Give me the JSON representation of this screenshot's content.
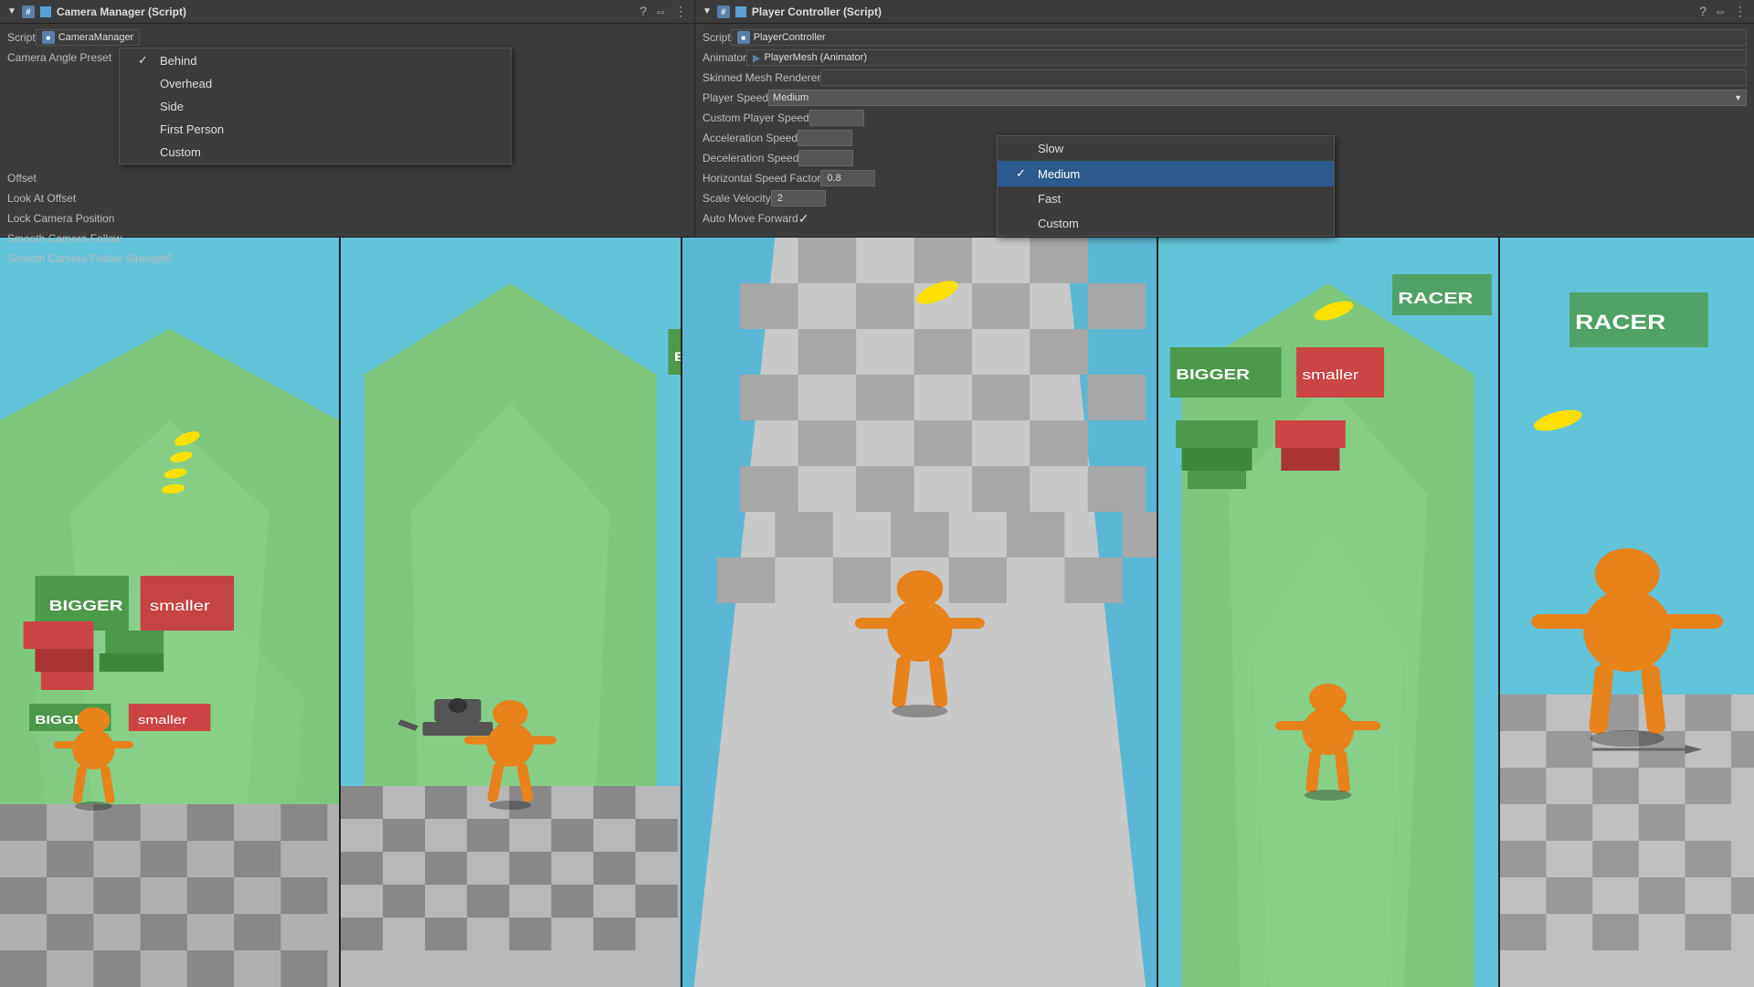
{
  "camera_panel": {
    "title": "Camera Manager (Script)",
    "script_field": "CameraManager",
    "fields": [
      {
        "label": "Script",
        "value": "CameraManager"
      },
      {
        "label": "Camera Angle Preset",
        "value": ""
      },
      {
        "label": "Offset",
        "value": ""
      },
      {
        "label": "Look At Offset",
        "value": ""
      },
      {
        "label": "Lock Camera Position",
        "value": ""
      },
      {
        "label": "Smooth Camera Follow",
        "value": ""
      },
      {
        "label": "Smooth Camera Follow Strength",
        "value": "6"
      }
    ],
    "dropdown": {
      "options": [
        {
          "label": "Behind",
          "selected": true
        },
        {
          "label": "Overhead",
          "selected": false
        },
        {
          "label": "Side",
          "selected": false
        },
        {
          "label": "First Person",
          "selected": false
        },
        {
          "label": "Custom",
          "selected": false
        }
      ]
    }
  },
  "player_panel": {
    "title": "Player Controller (Script)",
    "script_field": "PlayerController",
    "animator_label": "Animator",
    "animator_value": "PlayerMesh (Animator)",
    "skinned_mesh_label": "Skinned Mesh Renderer",
    "fields": [
      {
        "label": "Script",
        "value": "PlayerController"
      },
      {
        "label": "Animator",
        "value": "PlayerMesh (Animator)"
      },
      {
        "label": "Skinned Mesh Renderer",
        "value": ""
      },
      {
        "label": "Player Speed",
        "value": ""
      },
      {
        "label": "Custom Player Speed",
        "value": ""
      },
      {
        "label": "Acceleration Speed",
        "value": ""
      },
      {
        "label": "Deceleration Speed",
        "value": ""
      },
      {
        "label": "Horizontal Speed Factor",
        "value": "0.8"
      },
      {
        "label": "Scale Velocity",
        "value": "2"
      },
      {
        "label": "Auto Move Forward",
        "value": "✓"
      }
    ],
    "speed_dropdown": {
      "options": [
        {
          "label": "Slow",
          "selected": false
        },
        {
          "label": "Medium",
          "selected": true
        },
        {
          "label": "Fast",
          "selected": false
        },
        {
          "label": "Custom",
          "selected": false
        }
      ]
    }
  },
  "icons": {
    "question_mark": "?",
    "settings": "⚙",
    "more": "⋮",
    "checkmark": "✓",
    "arrow_right": "→",
    "triangle_down": "▼",
    "hash": "#",
    "animator_icon": "▶"
  },
  "colors": {
    "panel_bg": "#3c3c3c",
    "header_bg": "#3c3c3c",
    "border": "#232323",
    "text_primary": "#ddd",
    "text_secondary": "#bbb",
    "selected_bg": "#2d5a8e",
    "field_bg": "#555",
    "dropdown_bg": "#3c3c3c",
    "sky": "#62c4d8",
    "grass": "#7ec87e",
    "path_green": "#8ed48e",
    "character_body": "#e8821a",
    "bigger_block": "#4a4",
    "smaller_block": "#c44"
  }
}
